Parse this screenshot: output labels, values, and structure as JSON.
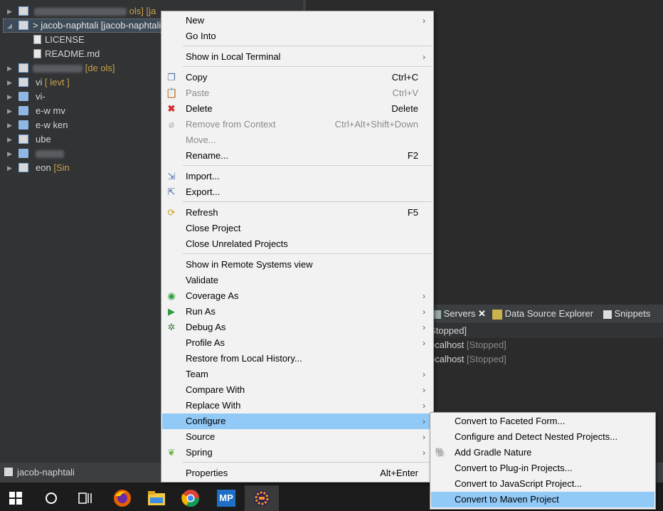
{
  "explorer": {
    "rows": [
      {
        "label": "",
        "suffix": ""
      },
      {
        "label": "> jacob-naphtali [jacob-naphtali",
        "suffix": ""
      },
      {
        "label": "LICENSE",
        "suffix": ""
      },
      {
        "label": "README.md",
        "suffix": ""
      },
      {
        "label": "",
        "suffix": "[de    ols]"
      },
      {
        "label": "vi",
        "suffix": "[    levt    ]"
      },
      {
        "label": "vi-",
        "suffix": ""
      },
      {
        "label": "e-w    mv",
        "suffix": ""
      },
      {
        "label": "e-w    ken",
        "suffix": ""
      },
      {
        "label": "ube",
        "suffix": ""
      },
      {
        "label": "",
        "suffix": ""
      },
      {
        "label": "eon",
        "suffix": "[Sin"
      }
    ],
    "top_suffix": "ols] [ja"
  },
  "context_menu": {
    "items": [
      {
        "label": "New",
        "shortcut": "",
        "submenu": true,
        "icon": "",
        "disabled": false
      },
      {
        "label": "Go Into",
        "shortcut": "",
        "submenu": false,
        "icon": "",
        "disabled": false
      },
      {
        "label": "Show in Local Terminal",
        "shortcut": "",
        "submenu": true,
        "icon": "",
        "disabled": false
      },
      {
        "label": "Copy",
        "shortcut": "Ctrl+C",
        "submenu": false,
        "icon": "copy-icon",
        "disabled": false
      },
      {
        "label": "Paste",
        "shortcut": "Ctrl+V",
        "submenu": false,
        "icon": "paste-icon",
        "disabled": true
      },
      {
        "label": "Delete",
        "shortcut": "Delete",
        "submenu": false,
        "icon": "delete-icon",
        "disabled": false
      },
      {
        "label": "Remove from Context",
        "shortcut": "Ctrl+Alt+Shift+Down",
        "submenu": false,
        "icon": "remove-context-icon",
        "disabled": true
      },
      {
        "label": "Move...",
        "shortcut": "",
        "submenu": false,
        "icon": "",
        "disabled": true
      },
      {
        "label": "Rename...",
        "shortcut": "F2",
        "submenu": false,
        "icon": "",
        "disabled": false
      },
      {
        "label": "Import...",
        "shortcut": "",
        "submenu": false,
        "icon": "import-icon",
        "disabled": false
      },
      {
        "label": "Export...",
        "shortcut": "",
        "submenu": false,
        "icon": "export-icon",
        "disabled": false
      },
      {
        "label": "Refresh",
        "shortcut": "F5",
        "submenu": false,
        "icon": "refresh-icon",
        "disabled": false
      },
      {
        "label": "Close Project",
        "shortcut": "",
        "submenu": false,
        "icon": "",
        "disabled": false
      },
      {
        "label": "Close Unrelated Projects",
        "shortcut": "",
        "submenu": false,
        "icon": "",
        "disabled": false
      },
      {
        "label": "Show in Remote Systems view",
        "shortcut": "",
        "submenu": false,
        "icon": "",
        "disabled": false
      },
      {
        "label": "Validate",
        "shortcut": "",
        "submenu": false,
        "icon": "",
        "disabled": false
      },
      {
        "label": "Coverage As",
        "shortcut": "",
        "submenu": true,
        "icon": "coverage-icon",
        "disabled": false
      },
      {
        "label": "Run As",
        "shortcut": "",
        "submenu": true,
        "icon": "run-icon",
        "disabled": false
      },
      {
        "label": "Debug As",
        "shortcut": "",
        "submenu": true,
        "icon": "debug-icon",
        "disabled": false
      },
      {
        "label": "Profile As",
        "shortcut": "",
        "submenu": true,
        "icon": "",
        "disabled": false
      },
      {
        "label": "Restore from Local History...",
        "shortcut": "",
        "submenu": false,
        "icon": "",
        "disabled": false
      },
      {
        "label": "Team",
        "shortcut": "",
        "submenu": true,
        "icon": "",
        "disabled": false
      },
      {
        "label": "Compare With",
        "shortcut": "",
        "submenu": true,
        "icon": "",
        "disabled": false
      },
      {
        "label": "Replace With",
        "shortcut": "",
        "submenu": true,
        "icon": "",
        "disabled": false
      },
      {
        "label": "Configure",
        "shortcut": "",
        "submenu": true,
        "icon": "",
        "disabled": false,
        "selected": true
      },
      {
        "label": "Source",
        "shortcut": "",
        "submenu": true,
        "icon": "",
        "disabled": false
      },
      {
        "label": "Spring",
        "shortcut": "",
        "submenu": true,
        "icon": "spring-icon",
        "disabled": false
      },
      {
        "label": "Properties",
        "shortcut": "Alt+Enter",
        "submenu": false,
        "icon": "",
        "disabled": false
      }
    ]
  },
  "configure_submenu": {
    "items": [
      {
        "label": "Convert to Faceted Form...",
        "icon": ""
      },
      {
        "label": "Configure and Detect Nested Projects...",
        "icon": ""
      },
      {
        "label": "Add Gradle Nature",
        "icon": "gradle-icon"
      },
      {
        "label": "Convert to Plug-in Projects...",
        "icon": ""
      },
      {
        "label": "Convert to JavaScript Project...",
        "icon": ""
      },
      {
        "label": "Convert to Maven Project",
        "icon": "",
        "selected": true
      }
    ]
  },
  "servers_panel": {
    "tabs": [
      {
        "label": "Servers",
        "icon": "servers-icon"
      },
      {
        "label": "Data Source Explorer",
        "icon": "data-source-icon"
      },
      {
        "label": "Snippets",
        "icon": "snippets-icon"
      }
    ],
    "rows": [
      {
        "name": "",
        "status": "Stopped]"
      },
      {
        "name": "ocalhost",
        "status": "[Stopped]"
      },
      {
        "name": "ocalhost",
        "status": "[Stopped]"
      }
    ]
  },
  "statusbar": {
    "selected_project": "jacob-naphtali"
  },
  "taskbar": {
    "items": [
      "windows-start-icon",
      "cortana-icon",
      "task-view-icon",
      "firefox-icon",
      "file-explorer-icon",
      "chrome-icon",
      "mp-app-icon",
      "eclipse-app-icon"
    ],
    "mp_label": "MP"
  }
}
